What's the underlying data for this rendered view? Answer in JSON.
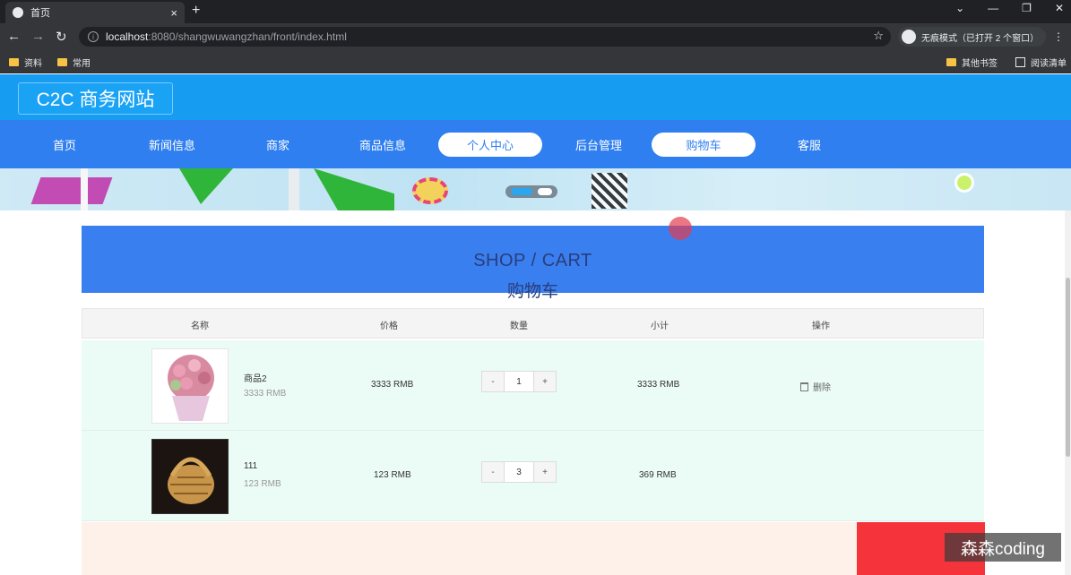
{
  "browser": {
    "tab_title": "首页",
    "tab_close": "×",
    "new_tab": "+",
    "url_host": "localhost",
    "url_rest": ":8080/shangwuwangzhan/front/index.html",
    "incognito_label": "无痕模式（已打开 2 个窗口）",
    "bookmarks": [
      "资料",
      "常用"
    ],
    "other_bookmarks": "其他书签",
    "reading_list": "阅读清单",
    "win_min": "—",
    "win_restore": "❐",
    "win_close": "✕",
    "chevron": "⌄"
  },
  "site": {
    "logo": "C2C 商务网站",
    "nav": [
      {
        "label": "首页"
      },
      {
        "label": "新闻信息"
      },
      {
        "label": "商家"
      },
      {
        "label": "商品信息"
      },
      {
        "label": "个人中心"
      },
      {
        "label": "后台管理"
      },
      {
        "label": "购物车"
      },
      {
        "label": "客服"
      }
    ]
  },
  "cart": {
    "title_en": "SHOP / CART",
    "title_zh": "购物车",
    "headers": {
      "name": "名称",
      "price": "价格",
      "qty": "数量",
      "subtotal": "小计",
      "action": "操作"
    },
    "items": [
      {
        "name": "商品2",
        "sub_price": "3333 RMB",
        "price": "3333 RMB",
        "qty": "1",
        "subtotal": "3333 RMB",
        "action": "删除"
      },
      {
        "name": "111",
        "sub_price": "123 RMB",
        "price": "123 RMB",
        "qty": "3",
        "subtotal": "369 RMB",
        "action": ""
      }
    ],
    "minus": "-",
    "plus": "+"
  },
  "watermark": "森森coding",
  "colors": {
    "header": "#169df2",
    "nav": "#2f7ff0",
    "cart_title_bg": "#3a7ff0",
    "row_bg": "#ebfbf5",
    "checkout": "#f4333a"
  }
}
